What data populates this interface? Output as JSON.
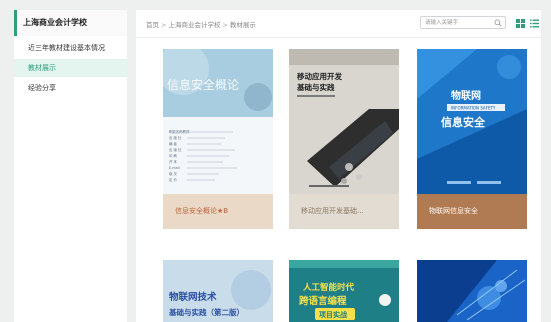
{
  "sidebar": {
    "title": "上海商业会计学校",
    "items": [
      {
        "label": "近三年教材建设基本情况",
        "active": false
      },
      {
        "label": "教材展示",
        "active": true
      },
      {
        "label": "经验分享",
        "active": false
      }
    ]
  },
  "breadcrumb": {
    "home": "首页",
    "sep": ">",
    "school": "上海商业会计学校",
    "current": "教材展示"
  },
  "search": {
    "placeholder": "请输入关键字"
  },
  "books": [
    {
      "caption": "信息安全概论★B",
      "cover_title": "信息安全概论",
      "cover_info": [
        "职能名称教材",
        "出 版 社",
        "编 者",
        "出 版 社",
        "印 刷",
        "开 本",
        "E-mail",
        "版 次",
        "定 价"
      ],
      "caption_color": "#e9d9c6",
      "caption_text_color": "#c0643a"
    },
    {
      "caption": "移动应用开发基础...",
      "cover_title_line1": "移动应用开发",
      "cover_title_line2": "基础与实践",
      "caption_color": "#e3dcd2",
      "caption_text_color": "#8a7a66"
    },
    {
      "caption": "物联网信息安全",
      "cover_title_line1": "物联网",
      "cover_subtitle": "INFORMATION SAFETY",
      "cover_title_line2": "信息安全",
      "caption_color": "#b07a52",
      "caption_text_color": "#ffffff"
    },
    {
      "cover_title_line1": "物联网技术",
      "cover_title_line2": "基础与实践（第二版）"
    },
    {
      "cover_title_line1": "人工智能时代",
      "cover_title_line2": "跨语言编程",
      "cover_title_line3": "项目实战"
    },
    {
      "cover_title_line1": ""
    }
  ],
  "colors": {
    "accent": "#2f9e7c",
    "active_bg": "#e4f4ee"
  },
  "icons": [
    "search-icon",
    "grid-view-icon",
    "list-view-icon"
  ]
}
